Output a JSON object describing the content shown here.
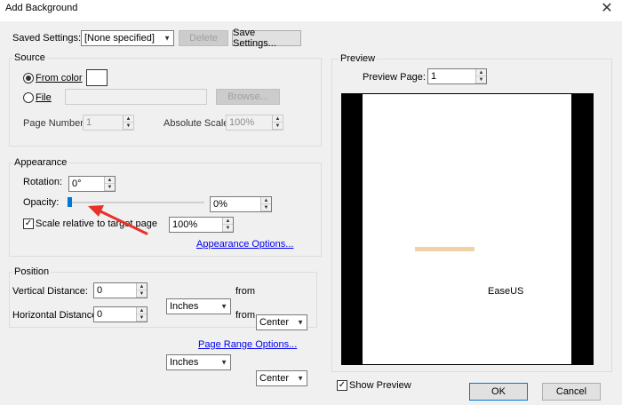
{
  "window": {
    "title": "Add Background",
    "close_glyph": "✕"
  },
  "saved_settings": {
    "label": "Saved Settings:",
    "selected": "[None specified]",
    "delete_label": "Delete",
    "save_label": "Save Settings..."
  },
  "source": {
    "group_title": "Source",
    "from_color_label": "From color",
    "from_color_selected": true,
    "color_swatch": "#ffffff",
    "file_label": "File",
    "file_value": "",
    "browse_label": "Browse...",
    "page_number_label": "Page Number:",
    "page_number_value": "1",
    "absolute_scale_label": "Absolute Scale:",
    "absolute_scale_value": "100%"
  },
  "appearance": {
    "group_title": "Appearance",
    "rotation_label": "Rotation:",
    "rotation_value": "0°",
    "opacity_label": "Opacity:",
    "opacity_value": "0%",
    "opacity_fraction": 0.0,
    "scale_relative_label": "Scale relative to target page",
    "scale_relative_checked": true,
    "scale_relative_value": "100%",
    "options_link": "Appearance Options..."
  },
  "position": {
    "group_title": "Position",
    "vertical_label": "Vertical Distance:",
    "vertical_value": "0",
    "vertical_unit": "Inches",
    "vertical_from_label": "from",
    "vertical_from": "Center",
    "horizontal_label": "Horizontal Distance:",
    "horizontal_value": "0",
    "horizontal_unit": "Inches",
    "horizontal_from_label": "from",
    "horizontal_from": "Center"
  },
  "page_range_link": "Page Range Options...",
  "preview": {
    "group_title": "Preview",
    "preview_page_label": "Preview Page:",
    "preview_page_value": "1",
    "page_text": "EaseUS",
    "show_preview_label": "Show Preview",
    "show_preview_checked": true
  },
  "footer": {
    "ok_label": "OK",
    "cancel_label": "Cancel"
  },
  "colors": {
    "accent": "#0078d7",
    "link": "#0000ee",
    "annotation_arrow": "#e8312a",
    "preview_border": "#000000"
  },
  "icons": {
    "dropdown": "chevron-down-icon",
    "spin_up": "spin-up-icon",
    "spin_down": "spin-down-icon",
    "check": "checkmark-icon"
  }
}
